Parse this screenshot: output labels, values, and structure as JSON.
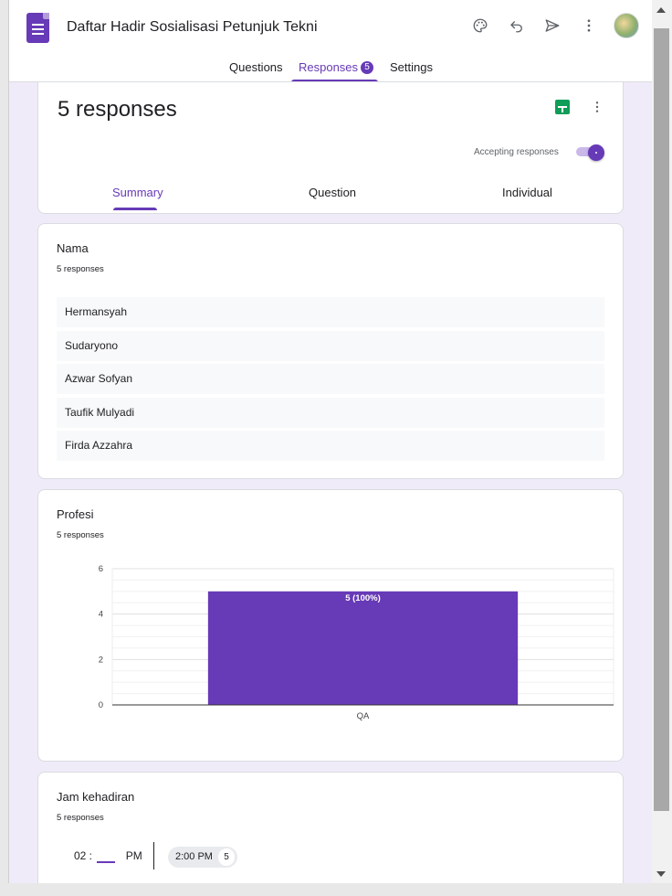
{
  "header": {
    "title": "Daftar Hadir Sosialisasi Petunjuk Teknis P",
    "icons": [
      "palette-icon",
      "undo-icon",
      "send-icon",
      "more-vert-icon",
      "avatar"
    ]
  },
  "tabs": [
    {
      "label": "Questions"
    },
    {
      "label": "Responses",
      "badge": "5"
    },
    {
      "label": "Settings"
    }
  ],
  "summary_card": {
    "title": "5 responses",
    "accepting_label": "Accepting responses",
    "accepting": true,
    "subtabs": [
      "Summary",
      "Question",
      "Individual"
    ]
  },
  "questions": [
    {
      "title": "Nama",
      "count": "5 responses",
      "answers": [
        "Hermansyah",
        "Sudaryono",
        "Azwar Sofyan",
        "Taufik Mulyadi",
        "Firda Azzahra"
      ]
    },
    {
      "title": "Profesi",
      "count": "5 responses"
    },
    {
      "title": "Jam kehadiran",
      "count": "5 responses",
      "time_hour": "02 :",
      "time_ampm": "PM",
      "chip_label": "2:00 PM",
      "chip_count": "5"
    }
  ],
  "chart_data": {
    "type": "bar",
    "categories": [
      "QA"
    ],
    "values": [
      5
    ],
    "data_labels": [
      "5 (100%)"
    ],
    "ylim": [
      0,
      6
    ],
    "yticks": [
      0,
      2,
      4,
      6
    ],
    "grid": true,
    "color": "#673ab7"
  },
  "colors": {
    "accent": "#673ab7",
    "background": "#f0ebf8",
    "sheets_green": "#0f9d58"
  }
}
